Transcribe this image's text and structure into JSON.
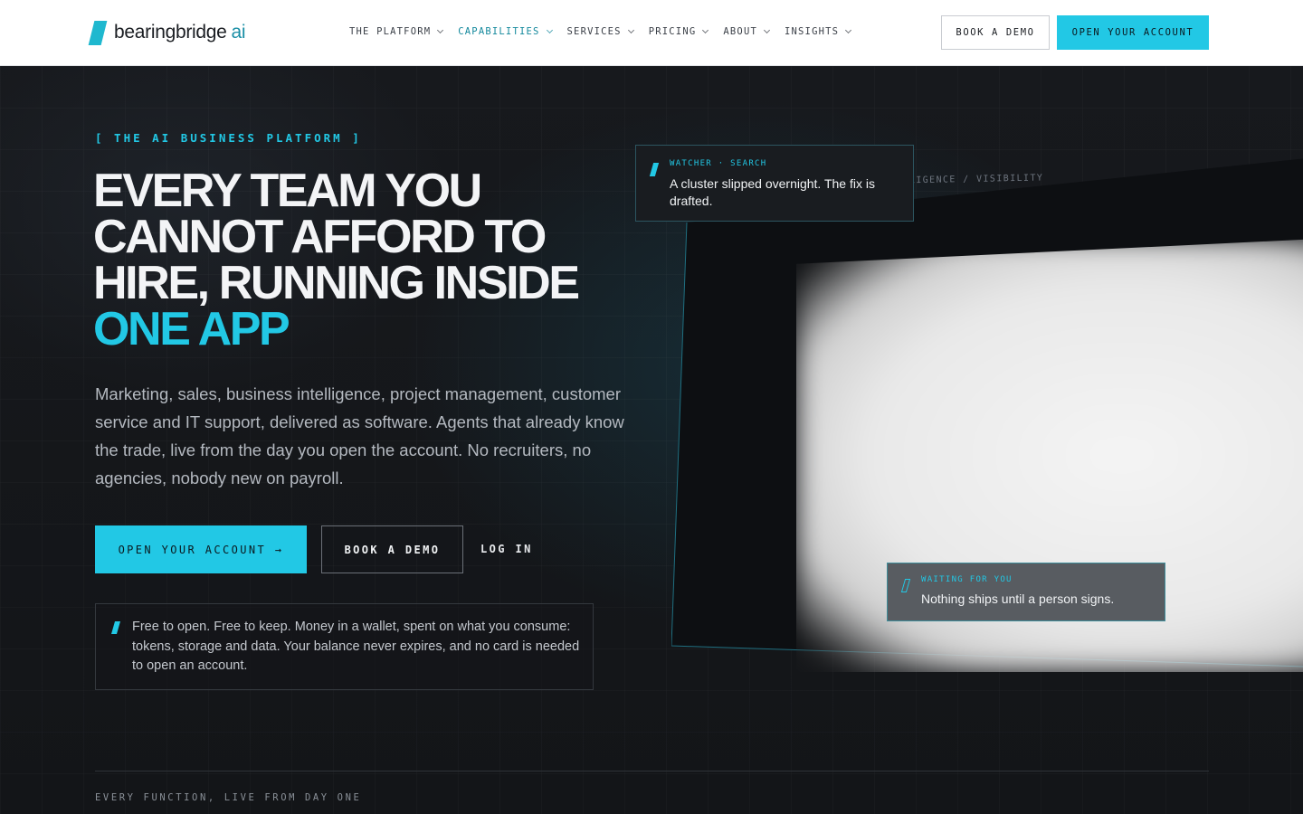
{
  "brand": {
    "name": "bearingbridge",
    "accent": "ai",
    "colors": {
      "accent": "#22c8e5",
      "dark_bg": "#141619",
      "nav_bg": "#ffffff"
    }
  },
  "nav": {
    "items": [
      {
        "label": "THE PLATFORM",
        "active": false
      },
      {
        "label": "CAPABILITIES",
        "active": true
      },
      {
        "label": "SERVICES",
        "active": false
      },
      {
        "label": "PRICING",
        "active": false
      },
      {
        "label": "ABOUT",
        "active": false
      },
      {
        "label": "INSIGHTS",
        "active": false
      }
    ],
    "book_demo_label": "BOOK A DEMO",
    "open_account_label": "OPEN YOUR ACCOUNT"
  },
  "hero": {
    "kicker": "[ THE AI BUSINESS PLATFORM ]",
    "headline_main": "EVERY TEAM YOU CANNOT AFFORD TO HIRE, RUNNING INSIDE",
    "headline_highlight": "ONE APP",
    "lede": "Marketing, sales, business intelligence, project management, customer service and IT support, delivered as software. Agents that already know the trade, live from the day you open the account. No recruiters, no agencies, nobody new on payroll.",
    "cta_primary": "OPEN YOUR ACCOUNT →",
    "cta_secondary": "BOOK A DEMO",
    "cta_login": "LOG IN",
    "note": "Free to open. Free to keep. Money in a wallet, spent on what you consume: tokens, storage and data. Your balance never expires, and no card is needed to open an account."
  },
  "preview": {
    "panel_label": "ELLIGENCE / VISIBILITY",
    "watcher": {
      "kicker": "WATCHER · SEARCH",
      "text": "A cluster slipped overnight. The fix is drafted."
    },
    "waiting": {
      "kicker": "WAITING FOR YOU",
      "text": "Nothing ships until a person signs."
    }
  },
  "section": {
    "kicker": "EVERY FUNCTION, LIVE FROM DAY ONE"
  }
}
